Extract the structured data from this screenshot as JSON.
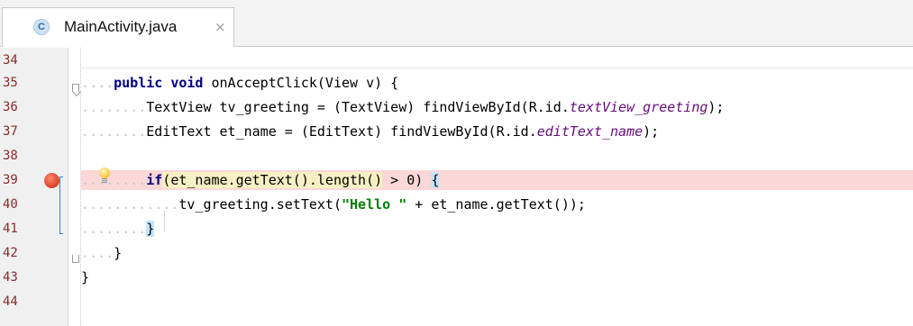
{
  "tab": {
    "icon_letter": "C",
    "title": "MainActivity.java",
    "close": "×"
  },
  "line_numbers": [
    "34",
    "35",
    "36",
    "37",
    "38",
    "39",
    "40",
    "41",
    "42",
    "43",
    "44"
  ],
  "code": {
    "l35": {
      "indent": "....",
      "kw1": "public",
      "kw2": "void",
      "rest": "onAcceptClick(View v) {"
    },
    "l36": {
      "indent": "........",
      "pre": "TextView tv_greeting = (TextView) findViewById(R.id.",
      "field": "textView_greeting",
      "post": ");"
    },
    "l37": {
      "indent": "........",
      "pre": "EditText et_name = (EditText) findViewById(R.id.",
      "field": "editText_name",
      "post": ");"
    },
    "l39": {
      "indent": "........",
      "kw": "if",
      "paren_open": "(",
      "expr": "et_name.getText().length()",
      "rest": " > 0",
      "paren_close": ")",
      "brace": "{"
    },
    "l40": {
      "indent": "............",
      "pre": "tv_greeting.setText(",
      "str": "\"Hello \"",
      "post": " + et_name.getText());"
    },
    "l41": {
      "indent": "........",
      "brace": "}"
    },
    "l42": {
      "indent": "....",
      "brace": "}"
    },
    "l43": {
      "brace": "}"
    }
  },
  "colors": {
    "keyword": "#00007f",
    "field": "#660e7a",
    "string": "#008000",
    "line_number": "#8a2b2b",
    "breakpoint_line": "#fbd7d7",
    "breakpoint": "#d9442b"
  },
  "icons": [
    "class-icon",
    "close-icon",
    "breakpoint-icon",
    "intention-bulb-icon",
    "fold-icon"
  ]
}
